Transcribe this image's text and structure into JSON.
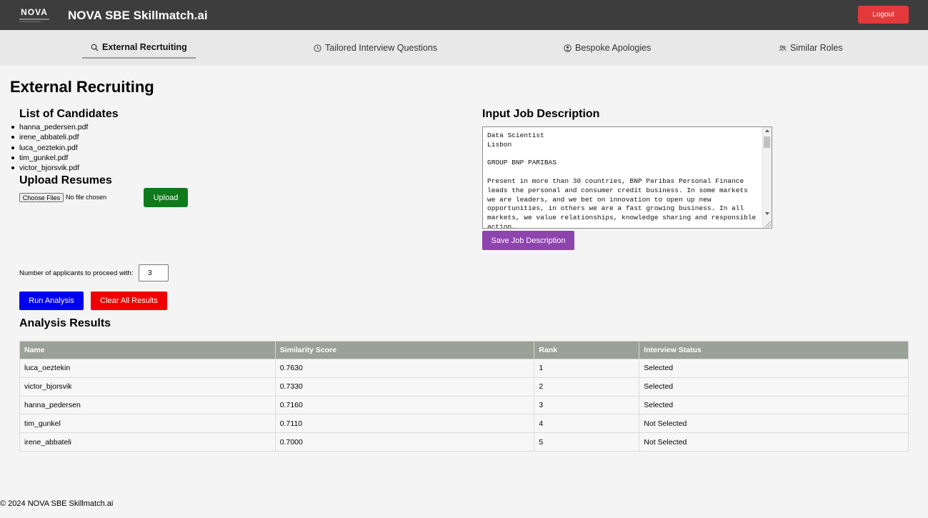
{
  "header": {
    "logo_text": "NOVA",
    "app_title": "NOVA SBE Skillmatch.ai",
    "logout_label": "Logout"
  },
  "nav": {
    "tabs": [
      {
        "label": "External Recrtuiting",
        "icon": "search-icon",
        "active": true
      },
      {
        "label": "Tailored Interview Questions",
        "icon": "clock-icon",
        "active": false
      },
      {
        "label": "Bespoke Apologies",
        "icon": "user-circle-icon",
        "active": false
      },
      {
        "label": "Similar Roles",
        "icon": "users-icon",
        "active": false
      }
    ]
  },
  "page": {
    "title": "External Recruiting"
  },
  "candidates": {
    "heading": "List of Candidates",
    "files": [
      "hanna_pedersen.pdf",
      "irene_abbateli.pdf",
      "luca_oeztekin.pdf",
      "tim_gunkel.pdf",
      "victor_bjorsvik.pdf"
    ]
  },
  "upload": {
    "heading": "Upload Resumes",
    "choose_label": "Choose Files",
    "no_file_text": "No file chosen",
    "upload_label": "Upload"
  },
  "applicants": {
    "label": "Number of applicants to proceed with:",
    "value": "3"
  },
  "actions": {
    "run_label": "Run Analysis",
    "clear_label": "Clear All Results"
  },
  "job_description": {
    "heading": "Input Job Description",
    "text": "Data Scientist\nLisbon\n\nGROUP BNP PARIBAS\n\nPresent in more than 30 countries, BNP Paribas Personal Finance leads the personal and consumer credit business. In some markets we are leaders, and we bet on innovation to open up new opportunities, in others we are a fast growing business. In all markets, we value relationships, knowledge sharing and responsible action.",
    "save_label": "Save Job Description"
  },
  "results": {
    "heading": "Analysis Results",
    "columns": [
      "Name",
      "Similarity Score",
      "Rank",
      "Interview Status"
    ],
    "rows": [
      [
        "luca_oeztekin",
        "0.7630",
        "1",
        "Selected"
      ],
      [
        "victor_bjorsvik",
        "0.7330",
        "2",
        "Selected"
      ],
      [
        "hanna_pedersen",
        "0.7160",
        "3",
        "Selected"
      ],
      [
        "tim_gunkel",
        "0.7110",
        "4",
        "Not Selected"
      ],
      [
        "irene_abbateli",
        "0.7000",
        "5",
        "Not Selected"
      ]
    ]
  },
  "footer": {
    "text": "© 2024 NOVA SBE Skillmatch.ai"
  },
  "colors": {
    "header_bg": "#3d3d3d",
    "logout": "#e5383b",
    "upload": "#0f7a1b",
    "run": "#0000f0",
    "clear": "#f00000",
    "save": "#8e44ad",
    "table_header": "#9aa196"
  }
}
